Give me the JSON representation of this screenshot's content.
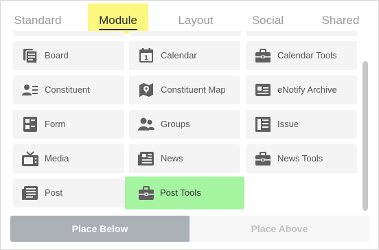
{
  "colors": {
    "tab_highlight": "#fcf77e",
    "tile_highlight": "#a5f49f",
    "icon": "#5f5f5f"
  },
  "tabs": [
    {
      "label": "Standard",
      "active": false
    },
    {
      "label": "Module",
      "active": true
    },
    {
      "label": "Layout",
      "active": false
    },
    {
      "label": "Social",
      "active": false
    },
    {
      "label": "Shared",
      "active": false
    }
  ],
  "modules": [
    {
      "label": "Board",
      "icon": "board-icon"
    },
    {
      "label": "Calendar",
      "icon": "calendar-icon"
    },
    {
      "label": "Calendar Tools",
      "icon": "toolbox-icon"
    },
    {
      "label": "Constituent",
      "icon": "constituent-icon"
    },
    {
      "label": "Constituent Map",
      "icon": "map-marker-icon"
    },
    {
      "label": "eNotify Archive",
      "icon": "enotify-icon"
    },
    {
      "label": "Form",
      "icon": "form-icon"
    },
    {
      "label": "Groups",
      "icon": "groups-icon"
    },
    {
      "label": "Issue",
      "icon": "issue-icon"
    },
    {
      "label": "Media",
      "icon": "tv-icon"
    },
    {
      "label": "News",
      "icon": "news-icon"
    },
    {
      "label": "News Tools",
      "icon": "toolbox-icon"
    },
    {
      "label": "Post",
      "icon": "post-icon"
    },
    {
      "label": "Post Tools",
      "icon": "toolbox-icon",
      "highlighted": true
    }
  ],
  "actions": {
    "place_below": "Place Below",
    "place_above": "Place Above"
  }
}
